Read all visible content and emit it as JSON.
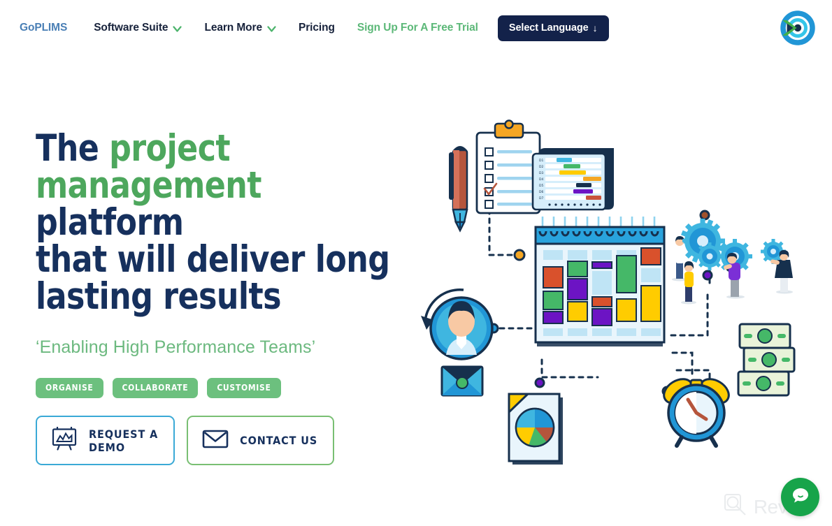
{
  "header": {
    "nav": [
      {
        "label": "GoPLIMS",
        "style": "brand",
        "has_caret": false
      },
      {
        "label": "Software Suite",
        "style": "plain",
        "has_caret": true
      },
      {
        "label": "Learn More",
        "style": "plain",
        "has_caret": true
      },
      {
        "label": "Pricing",
        "style": "plain",
        "has_caret": false
      },
      {
        "label": "Sign Up For A Free Trial",
        "style": "accent",
        "has_caret": false
      }
    ],
    "language_button": {
      "label": "Select Language",
      "arrow": "↓"
    },
    "logo_name": "goplims-logo"
  },
  "hero": {
    "headline": {
      "line1_a": "The ",
      "line1_green": "project",
      "line2_green": "management",
      "line2_b": " platform",
      "line3": "that will deliver long",
      "line4": "lasting results",
      "full_text": "The project management platform that will deliver long lasting results"
    },
    "subtitle": "‘Enabling High Performance Teams’",
    "badges": [
      {
        "label": "ORGANISE"
      },
      {
        "label": "COLLABORATE"
      },
      {
        "label": "CUSTOMISE"
      }
    ],
    "cta": [
      {
        "label": "REQUEST A\nDEMO",
        "icon": "presentation-chart-icon",
        "border": "#3aa9d6"
      },
      {
        "label": "CONTACT US",
        "icon": "envelope-icon",
        "border": "#79bf73"
      }
    ]
  },
  "illustration": {
    "name": "project-management-illustration",
    "elements": [
      "fountain-pen",
      "clipboard-checklist",
      "gantt-chart-board",
      "wall-calendar",
      "user-avatar",
      "email-envelope",
      "gears-and-people",
      "alarm-clock",
      "money-stack",
      "pie-chart-document"
    ],
    "calendar": {
      "blocks": [
        {
          "col": 0,
          "row": 0,
          "color": "#bfe4f5"
        },
        {
          "col": 1,
          "row": 0,
          "color": "#bfe4f5"
        },
        {
          "col": 2,
          "row": 0,
          "color": "#bfe4f5"
        },
        {
          "col": 3,
          "row": 0,
          "color": "#bfe4f5"
        },
        {
          "col": 4,
          "row": 0,
          "color": "#dc4f2c"
        },
        {
          "col": 0,
          "row": 1,
          "color": "#dc4f2c"
        },
        {
          "col": 1,
          "row": 1,
          "color": "#45b868"
        },
        {
          "col": 2,
          "row": 1,
          "color": "#6c14c4"
        },
        {
          "col": 3,
          "row": 1,
          "color": "#45b868"
        },
        {
          "col": 4,
          "row": 1,
          "color": "#bfe4f5"
        },
        {
          "col": 1,
          "row": 2,
          "color": "#6c14c4"
        },
        {
          "col": 2,
          "row": 2,
          "color": "#bfe4f5"
        },
        {
          "col": 0,
          "row": 3,
          "color": "#45b868"
        },
        {
          "col": 1,
          "row": 3,
          "color": "#ffcc00"
        },
        {
          "col": 2,
          "row": 3,
          "color": "#dc4f2c"
        },
        {
          "col": 3,
          "row": 3,
          "color": "#ffcc00"
        },
        {
          "col": 4,
          "row": 3,
          "color": "#ffcc00"
        },
        {
          "col": 0,
          "row": 4,
          "color": "#6c14c4"
        },
        {
          "col": 2,
          "row": 4,
          "color": "#6c14c4"
        }
      ]
    },
    "gantt_rows": [
      "D1",
      "D2",
      "D3",
      "D4",
      "D5",
      "D6",
      "D7"
    ]
  },
  "chat": {
    "name": "live-chat-button",
    "color": "#17a44a"
  },
  "watermark": {
    "text": "Revain"
  },
  "colors": {
    "navy": "#16305d",
    "green": "#4da75d",
    "badge_green": "#6cc07e",
    "link_green": "#5cb878",
    "brand_blue": "#4a7fb5",
    "button_navy": "#13224a",
    "cta_blue_border": "#3aa9d6",
    "cta_green_border": "#79bf73",
    "chat_green": "#17a44a"
  }
}
